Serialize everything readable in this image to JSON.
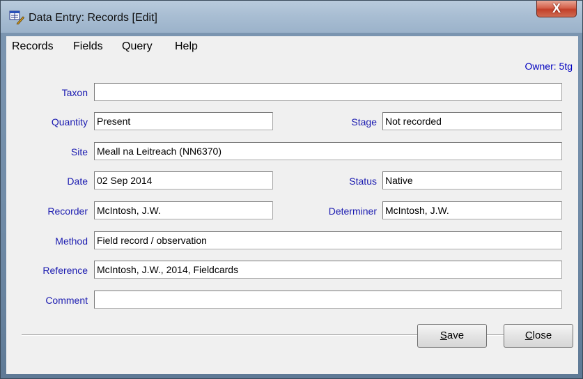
{
  "window": {
    "title": "Data Entry: Records [Edit]",
    "close_glyph": "X"
  },
  "menu": [
    "Records",
    "Fields",
    "Query",
    "Help"
  ],
  "owner": "Owner: 5tg",
  "form": {
    "taxon": {
      "label": "Taxon",
      "value": ""
    },
    "quantity": {
      "label": "Quantity",
      "value": "Present"
    },
    "stage": {
      "label": "Stage",
      "value": "Not recorded"
    },
    "site": {
      "label": "Site",
      "value": "Meall na Leitreach (NN6370)"
    },
    "date": {
      "label": "Date",
      "value": "02 Sep 2014"
    },
    "status": {
      "label": "Status",
      "value": "Native"
    },
    "recorder": {
      "label": "Recorder",
      "value": "McIntosh, J.W."
    },
    "determiner": {
      "label": "Determiner",
      "value": "McIntosh, J.W."
    },
    "method": {
      "label": "Method",
      "value": "Field record / observation"
    },
    "reference": {
      "label": "Reference",
      "value": "McIntosh, J.W., 2014, Fieldcards"
    },
    "comment": {
      "label": "Comment",
      "value": ""
    }
  },
  "buttons": {
    "save": {
      "mnemonic": "S",
      "rest": "ave"
    },
    "close": {
      "mnemonic": "C",
      "rest": "lose"
    }
  },
  "icons": {
    "window": "data-entry-icon"
  }
}
